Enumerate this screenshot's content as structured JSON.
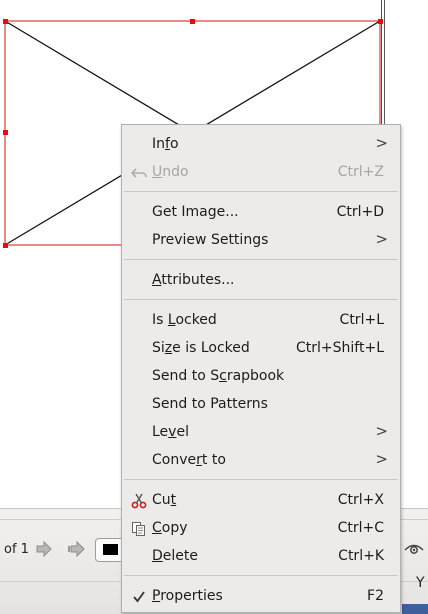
{
  "menu": {
    "items": [
      {
        "label": "Info",
        "mnemonic": "f",
        "accel": "",
        "submenu": true,
        "disabled": false,
        "icon": ""
      },
      {
        "label": "Undo",
        "mnemonic": "U",
        "accel": "Ctrl+Z",
        "submenu": false,
        "disabled": true,
        "icon": "undo-icon"
      },
      {
        "label": "Get Image...",
        "mnemonic": "",
        "accel": "Ctrl+D",
        "submenu": false,
        "disabled": false,
        "icon": ""
      },
      {
        "label": "Preview Settings",
        "mnemonic": "",
        "accel": "",
        "submenu": true,
        "disabled": false,
        "icon": ""
      },
      {
        "label": "Attributes...",
        "mnemonic": "A",
        "accel": "",
        "submenu": false,
        "disabled": false,
        "icon": ""
      },
      {
        "label": "Is Locked",
        "mnemonic": "L",
        "accel": "Ctrl+L",
        "submenu": false,
        "disabled": false,
        "icon": ""
      },
      {
        "label": "Size is Locked",
        "mnemonic": "z",
        "accel": "Ctrl+Shift+L",
        "submenu": false,
        "disabled": false,
        "icon": ""
      },
      {
        "label": "Send to Scrapbook",
        "mnemonic": "c",
        "accel": "",
        "submenu": false,
        "disabled": false,
        "icon": ""
      },
      {
        "label": "Send to Patterns",
        "mnemonic": "",
        "accel": "",
        "submenu": false,
        "disabled": false,
        "icon": ""
      },
      {
        "label": "Level",
        "mnemonic": "v",
        "accel": "",
        "submenu": true,
        "disabled": false,
        "icon": ""
      },
      {
        "label": "Convert to",
        "mnemonic": "r",
        "accel": "",
        "submenu": true,
        "disabled": false,
        "icon": ""
      },
      {
        "label": "Cut",
        "mnemonic": "t",
        "accel": "Ctrl+X",
        "submenu": false,
        "disabled": false,
        "icon": "scissors-icon"
      },
      {
        "label": "Copy",
        "mnemonic": "C",
        "accel": "Ctrl+C",
        "submenu": false,
        "disabled": false,
        "icon": "copy-icon"
      },
      {
        "label": "Delete",
        "mnemonic": "D",
        "accel": "Ctrl+K",
        "submenu": false,
        "disabled": false,
        "icon": ""
      },
      {
        "label": "Properties",
        "mnemonic": "P",
        "accel": "F2",
        "submenu": false,
        "disabled": false,
        "icon": "checkmark-icon"
      }
    ],
    "submenu_glyph": ">"
  },
  "status_bar": {
    "page_of": "of 1",
    "fill_color": "#000000",
    "trailing_text": "Y"
  },
  "colors": {
    "frame_line": "#e01010",
    "menu_background": "#ecebe9",
    "disabled_text": "#a8a6a3"
  }
}
